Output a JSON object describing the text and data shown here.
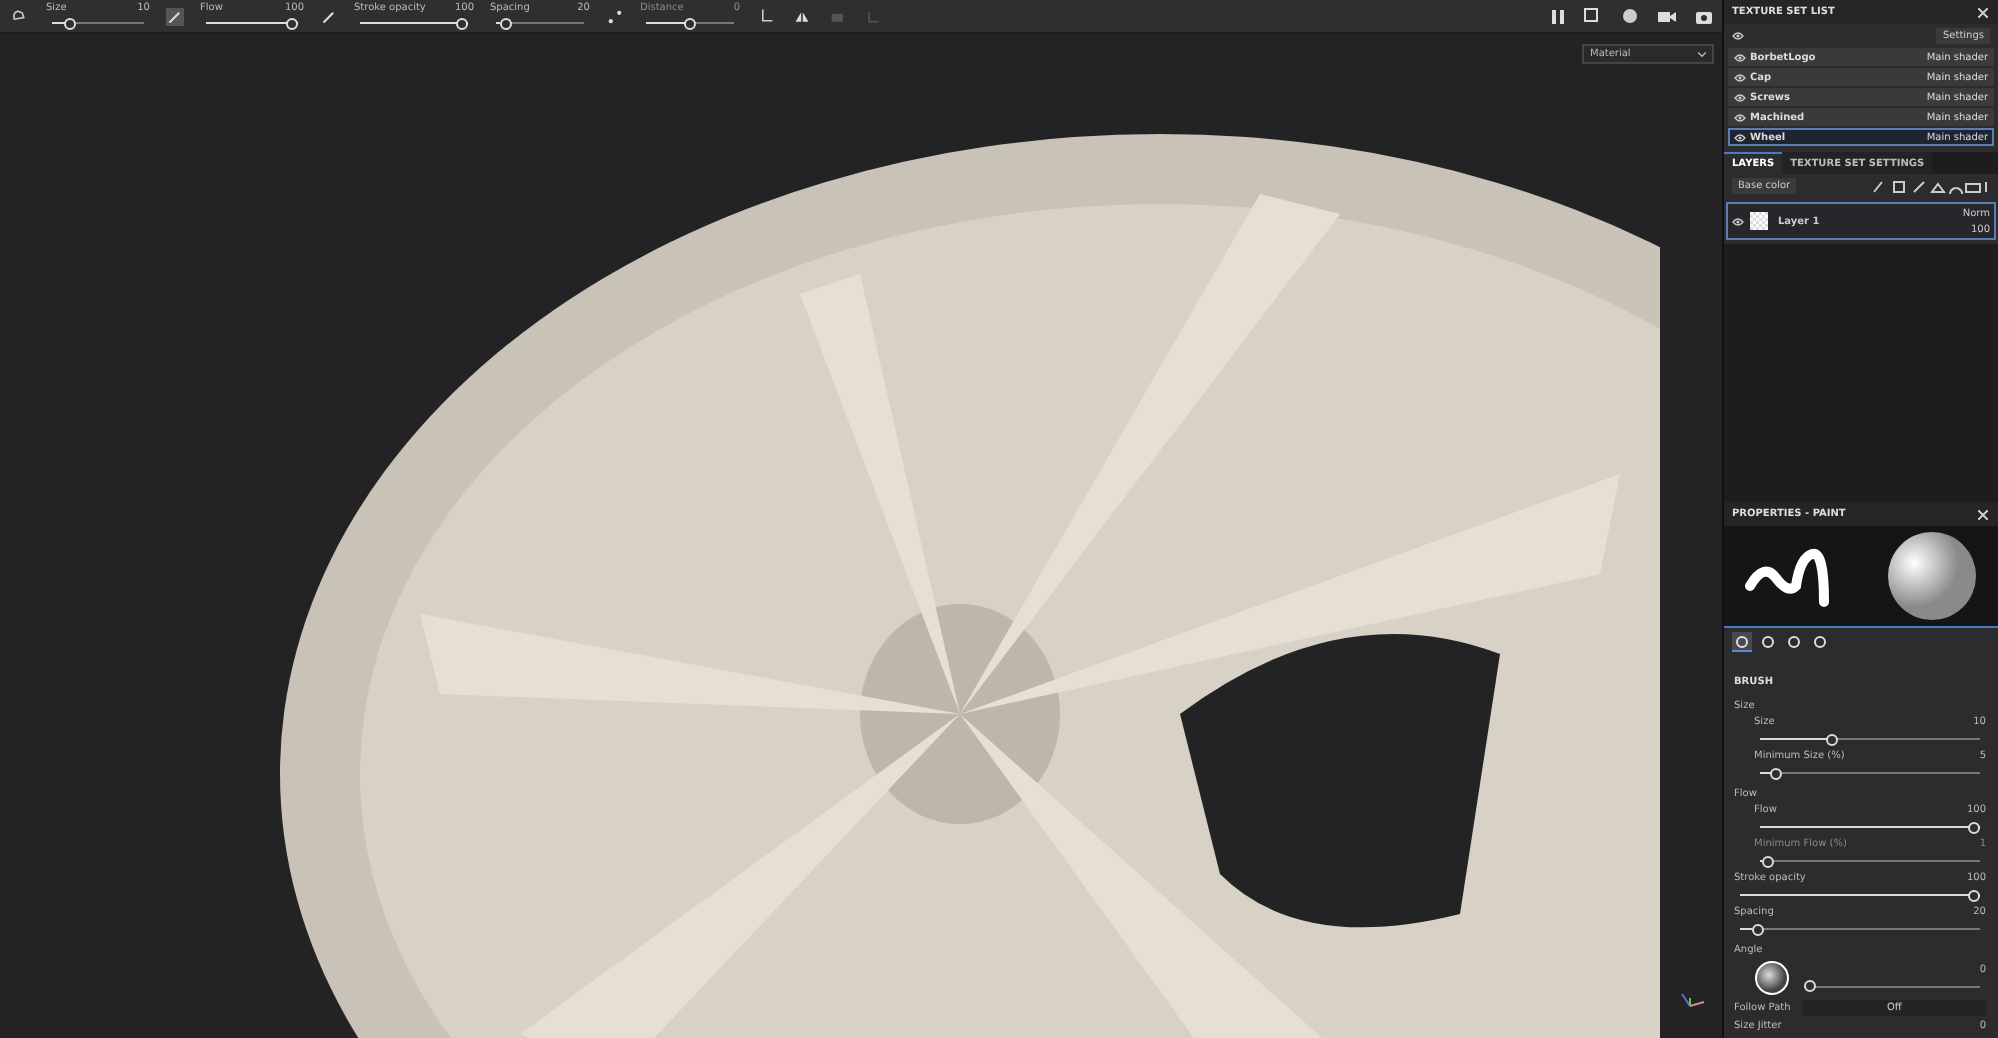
{
  "toolbar": {
    "sliders": [
      {
        "label": "Size",
        "value": "10",
        "level": 0.15,
        "disabled": false
      },
      {
        "label": "Flow",
        "value": "100",
        "level": 1,
        "disabled": false
      },
      {
        "label": "Stroke opacity",
        "value": "100",
        "level": 1,
        "disabled": false
      },
      {
        "label": "Spacing",
        "value": "20",
        "level": 0.05,
        "disabled": false
      },
      {
        "label": "Distance",
        "value": "0",
        "level": 0.5,
        "disabled": true
      }
    ]
  },
  "viewport": {
    "material_dropdown": "Material"
  },
  "texture_set_list": {
    "title": "TEXTURE SET LIST",
    "settings": "Settings",
    "items": [
      {
        "name": "BorbetLogo",
        "shader": "Main shader",
        "selected": false
      },
      {
        "name": "Cap",
        "shader": "Main shader",
        "selected": false
      },
      {
        "name": "Screws",
        "shader": "Main shader",
        "selected": false
      },
      {
        "name": "Machined",
        "shader": "Main shader",
        "selected": false
      },
      {
        "name": "Wheel",
        "shader": "Main shader",
        "selected": true
      }
    ]
  },
  "layers": {
    "tabs": [
      {
        "label": "LAYERS",
        "selected": true
      },
      {
        "label": "TEXTURE SET SETTINGS",
        "selected": false
      }
    ],
    "channel": "Base color",
    "items": [
      {
        "name": "Layer 1",
        "blend": "Norm",
        "opacity": "100",
        "selected": true
      }
    ]
  },
  "properties": {
    "title": "PROPERTIES - PAINT",
    "tabs": [
      {
        "selected": true
      },
      {
        "selected": false
      },
      {
        "selected": false
      },
      {
        "selected": false
      }
    ],
    "section": "BRUSH",
    "rows": [
      {
        "kind": "heading",
        "label": "Size"
      },
      {
        "kind": "slider",
        "label": "Size",
        "value": "10",
        "level": 0.32,
        "indent": true,
        "disabled": false
      },
      {
        "kind": "slider",
        "label": "Minimum Size (%)",
        "value": "5",
        "level": 0.05,
        "indent": true,
        "disabled": false
      },
      {
        "kind": "heading",
        "label": "Flow"
      },
      {
        "kind": "slider",
        "label": "Flow",
        "value": "100",
        "level": 1,
        "indent": true,
        "disabled": false
      },
      {
        "kind": "slider",
        "label": "Minimum Flow (%)",
        "value": "1",
        "level": 0.01,
        "indent": true,
        "disabled": true
      },
      {
        "kind": "slider",
        "label": "Stroke opacity",
        "value": "100",
        "level": 1,
        "indent": false,
        "disabled": false
      },
      {
        "kind": "slider",
        "label": "Spacing",
        "value": "20",
        "level": 0.05,
        "indent": false,
        "disabled": false
      },
      {
        "kind": "angle",
        "label": "Angle",
        "value": "0",
        "level": 0
      },
      {
        "kind": "toggle",
        "label": "Follow Path",
        "value": "Off"
      },
      {
        "kind": "number",
        "label": "Size Jitter",
        "value": "0"
      }
    ]
  }
}
